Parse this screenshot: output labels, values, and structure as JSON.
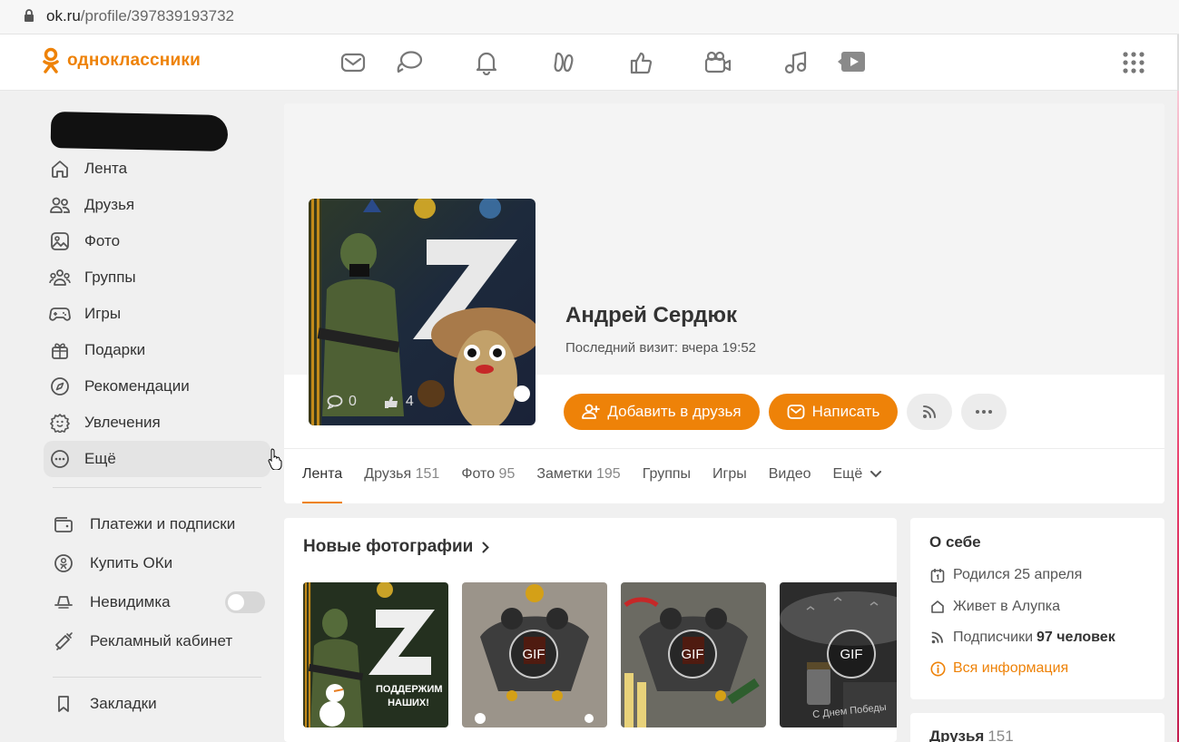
{
  "browser": {
    "domain": "ok.ru",
    "path": "/profile/397839193732"
  },
  "header": {
    "brand": "одноклассники",
    "nav_icons": [
      "mail-icon",
      "discussions-icon",
      "notifications-icon",
      "guests-icon",
      "likes-icon",
      "video-calls-icon",
      "music-icon",
      "video-icon"
    ]
  },
  "sidebar": {
    "items": [
      {
        "label": "Лента",
        "icon": "home-icon"
      },
      {
        "label": "Друзья",
        "icon": "friends-icon"
      },
      {
        "label": "Фото",
        "icon": "photo-icon"
      },
      {
        "label": "Группы",
        "icon": "groups-icon"
      },
      {
        "label": "Игры",
        "icon": "gamepad-icon"
      },
      {
        "label": "Подарки",
        "icon": "gift-icon"
      },
      {
        "label": "Рекомендации",
        "icon": "compass-icon"
      },
      {
        "label": "Увлечения",
        "icon": "hobbies-icon"
      },
      {
        "label": "Ещё",
        "icon": "more-icon"
      }
    ],
    "secondary": [
      {
        "label": "Платежи и подписки",
        "icon": "wallet-icon"
      },
      {
        "label": "Купить ОКи",
        "icon": "ok-coin-icon"
      },
      {
        "label": "Невидимка",
        "icon": "incognito-icon"
      },
      {
        "label": "Рекламный кабинет",
        "icon": "megaphone-icon"
      }
    ],
    "bookmarks": "Закладки"
  },
  "profile": {
    "name": "Андрей Сердюк",
    "last_visit": "Последний визит: вчера 19:52",
    "avatar_comments": "0",
    "avatar_likes": "4",
    "add_friend": "Добавить в друзья",
    "write": "Написать",
    "tabs": [
      {
        "label": "Лента",
        "count": ""
      },
      {
        "label": "Друзья",
        "count": "151"
      },
      {
        "label": "Фото",
        "count": "95"
      },
      {
        "label": "Заметки",
        "count": "195"
      },
      {
        "label": "Группы",
        "count": ""
      },
      {
        "label": "Игры",
        "count": ""
      },
      {
        "label": "Видео",
        "count": ""
      },
      {
        "label": "Ещё",
        "count": ""
      }
    ]
  },
  "photos": {
    "title": "Новые фотографии",
    "gif_label": "GIF",
    "thumb_caption_1": "ПОДДЕРЖИМ НАШИХ!",
    "thumb_caption_4": "С Днем Победы"
  },
  "about": {
    "title": "О себе",
    "birthday": "Родился 25 апреля",
    "lives": "Живет в Алупка",
    "followers_label": "Подписчики",
    "followers_value": "97 человек",
    "all_info": "Вся информация"
  },
  "friends_card": {
    "title": "Друзья",
    "count": "151"
  },
  "colors": {
    "accent": "#ee8208",
    "text": "#333333",
    "muted": "#888888"
  }
}
